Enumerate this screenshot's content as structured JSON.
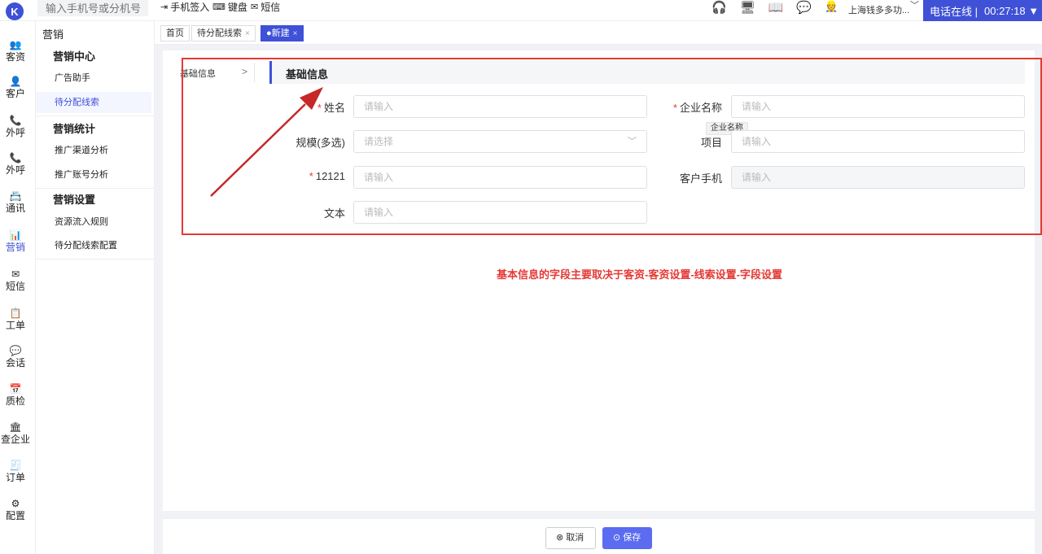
{
  "topbar": {
    "logo_letter": "K",
    "search_placeholder": "输入手机号或分机号",
    "quick_actions": [
      {
        "icon": "sign-in-icon",
        "glyph": "⇥",
        "label": "手机签入"
      },
      {
        "icon": "keyboard-icon",
        "glyph": "⌨",
        "label": "键盘"
      },
      {
        "icon": "mail-icon",
        "glyph": "✉",
        "label": "短信"
      }
    ],
    "header_icons": [
      {
        "name": "headset-icon",
        "glyph": "🎧"
      },
      {
        "name": "monitor-icon",
        "glyph": "🖥"
      },
      {
        "name": "book-icon",
        "glyph": "📖"
      },
      {
        "name": "chat-icon",
        "glyph": "💬"
      }
    ],
    "user_name": "上海钱多多功...",
    "phone_status": "电话在线 |",
    "call_timer": "00:27:18 ▼"
  },
  "icon_sidebar": [
    {
      "icon": "customer-pool-icon",
      "glyph": "👥",
      "label": "客资"
    },
    {
      "icon": "customer-icon",
      "glyph": "👤",
      "label": "客户"
    },
    {
      "icon": "outbound-call-icon",
      "glyph": "📞",
      "label": "外呼"
    },
    {
      "icon": "outbound-call-2-icon",
      "glyph": "📞",
      "label": "外呼"
    },
    {
      "icon": "contacts-icon",
      "glyph": "📇",
      "label": "通讯"
    },
    {
      "icon": "marketing-icon",
      "glyph": "📊",
      "label": "营销",
      "active": true
    },
    {
      "icon": "sms-icon",
      "glyph": "✉",
      "label": "短信"
    },
    {
      "icon": "ticket-icon",
      "glyph": "📋",
      "label": "工单"
    },
    {
      "icon": "conversation-icon",
      "glyph": "💬",
      "label": "会话"
    },
    {
      "icon": "quality-check-icon",
      "glyph": "📅",
      "label": "质检"
    },
    {
      "icon": "company-search-icon",
      "glyph": "🏛",
      "label": "查企业"
    },
    {
      "icon": "order-icon",
      "glyph": "🧾",
      "label": "订单"
    },
    {
      "icon": "settings-icon",
      "glyph": "⚙",
      "label": "配置"
    }
  ],
  "submenu": {
    "title": "营销",
    "groups": [
      {
        "title": "营销中心",
        "items": [
          "广告助手",
          "待分配线索"
        ]
      },
      {
        "title": "营销统计",
        "items": [
          "推广渠道分析",
          "推广账号分析"
        ]
      },
      {
        "title": "营销设置",
        "items": [
          "资源流入规则",
          "待分配线索配置"
        ]
      }
    ],
    "active_item": "待分配线索"
  },
  "tabs": [
    {
      "label": "首页",
      "closable": false
    },
    {
      "label": "待分配线索",
      "closable": true
    },
    {
      "label": "●新建",
      "closable": true,
      "active": true
    }
  ],
  "form": {
    "anchor_label": "基础信息",
    "anchor_chevron": ">",
    "section_title": "基础信息",
    "fields": {
      "name": {
        "label": "姓名",
        "required": true,
        "placeholder": "请输入"
      },
      "company": {
        "label": "企业名称",
        "required": true,
        "placeholder": "请输入"
      },
      "scale": {
        "label": "规模(多选)",
        "required": false,
        "placeholder": "请选择"
      },
      "project": {
        "label": "项目",
        "required": false,
        "placeholder": "请输入"
      },
      "field_12121": {
        "label": "12121",
        "required": true,
        "placeholder": "请输入"
      },
      "mobile": {
        "label": "客户手机",
        "required": false,
        "placeholder": "请输入",
        "disabled": true
      },
      "text": {
        "label": "文本",
        "required": false,
        "placeholder": "请输入"
      }
    },
    "tooltip": "企业名称"
  },
  "annotation": {
    "note": "基本信息的字段主要取决于客资-客资设置-线索设置-字段设置",
    "color": "#e53935"
  },
  "footer": {
    "cancel_label": "取消",
    "save_label": "保存"
  },
  "colors": {
    "brand": "#3f51d6",
    "save_button": "#5b6cf0",
    "required": "#e53935"
  }
}
